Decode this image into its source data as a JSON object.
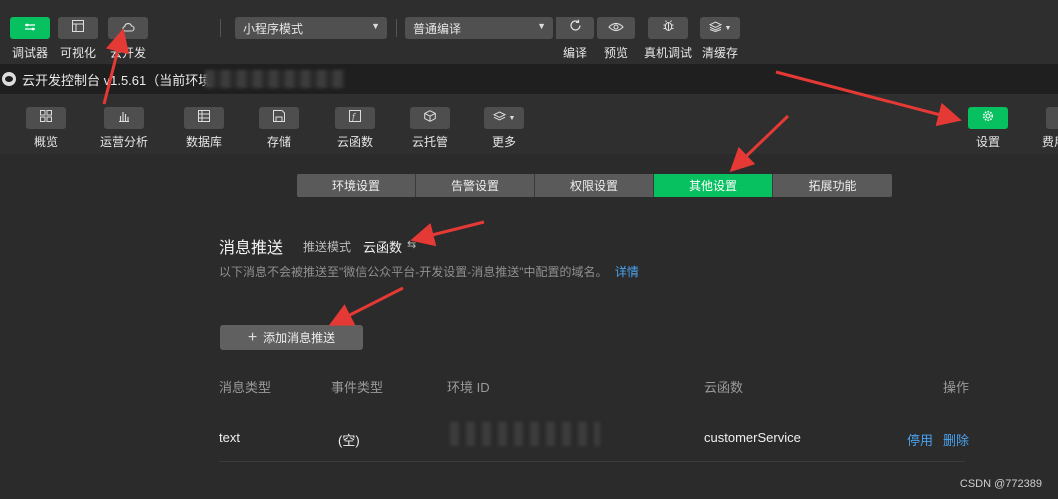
{
  "toolbar": {
    "debugger_label": "调试器",
    "visualize_label": "可视化",
    "cloud_label": "云开发",
    "mode_select": "小程序模式",
    "compile_select": "普通编译",
    "compile_label": "编译",
    "preview_label": "预览",
    "real_debug_label": "真机调试",
    "clear_cache_label": "清缓存"
  },
  "console": {
    "title": "云开发控制台 v1.5.61（当前环境"
  },
  "nav": {
    "overview": "概览",
    "analytics": "运营分析",
    "database": "数据库",
    "storage": "存储",
    "functions": "云函数",
    "hosting": "云托管",
    "more": "更多",
    "settings": "设置",
    "billing": "费用"
  },
  "tabs": [
    {
      "label": "环境设置",
      "active": false
    },
    {
      "label": "告警设置",
      "active": false
    },
    {
      "label": "权限设置",
      "active": false
    },
    {
      "label": "其他设置",
      "active": true
    },
    {
      "label": "拓展功能",
      "active": false
    }
  ],
  "push": {
    "title": "消息推送",
    "mode_label": "推送模式",
    "mode_value": "云函数",
    "swap_icon": "⇆",
    "description": "以下消息不会被推送至\"微信公众平台-开发设置-消息推送\"中配置的域名。",
    "detail_link": "详情",
    "add_button": "添加消息推送"
  },
  "table": {
    "headers": {
      "msg_type": "消息类型",
      "event_type": "事件类型",
      "env_id": "环境 ID",
      "function": "云函数",
      "action": "操作"
    },
    "rows": [
      {
        "msg_type": "text",
        "event_type": "(空)",
        "function": "customerService",
        "enable": "停用",
        "delete": "删除"
      }
    ]
  },
  "watermark": "CSDN @772389",
  "colors": {
    "accent": "#07c160",
    "link": "#4aa3f0",
    "annotation": "#e53935"
  },
  "icons": [
    "code-icon",
    "layout-icon",
    "cloud-icon",
    "refresh-icon",
    "eye-icon",
    "bug-icon",
    "layers-icon",
    "grid-icon",
    "bar-chart-icon",
    "database-icon",
    "save-icon",
    "function-icon",
    "box-icon",
    "gear-icon",
    "plus-icon",
    "swap-icon"
  ]
}
